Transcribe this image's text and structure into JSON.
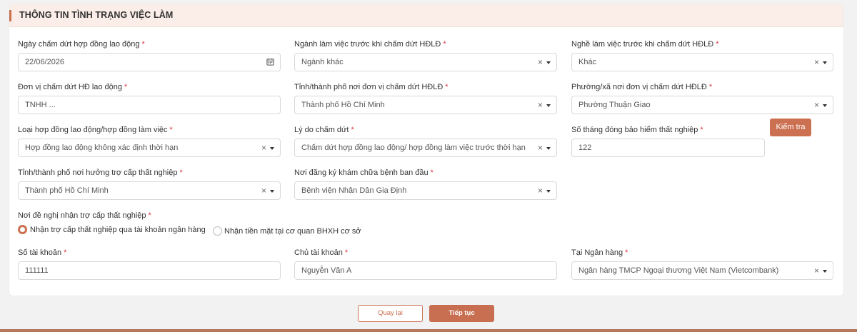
{
  "section": {
    "title": "THÔNG TIN TÌNH TRẠNG VIỆC LÀM"
  },
  "fields": {
    "termination_date": {
      "label": "Ngày chấm dứt hợp đồng lao động",
      "value": "22/06/2026",
      "required": "*"
    },
    "industry": {
      "label": "Ngành làm việc trước khi chấm dứt HĐLĐ",
      "value": "Ngành khác",
      "required": "*"
    },
    "occupation": {
      "label": "Nghề làm việc trước khi chấm dứt HĐLĐ",
      "value": "Khác",
      "required": "*"
    },
    "employer": {
      "label": "Đơn vị chấm dứt HĐ lao động",
      "value": "TNHH ...",
      "required": "*"
    },
    "employer_province": {
      "label": "Tỉnh/thành phố nơi đơn vị chấm dứt HĐLĐ",
      "value": "Thành phố Hồ Chí Minh",
      "required": "*"
    },
    "employer_ward": {
      "label": "Phường/xã nơi đơn vị chấm dứt HĐLĐ",
      "value": "Phường Thuận Giao",
      "required": "*"
    },
    "contract_type": {
      "label": "Loại hợp đồng lao động/hợp đồng làm việc",
      "value": "Hợp đồng lao động không xác định thời hạn",
      "required": "*"
    },
    "termination_reason": {
      "label": "Lý do chấm dứt",
      "value": "Chấm dứt hợp đồng lao động/ hợp đồng làm việc trước thời hạn",
      "required": "*"
    },
    "insurance_months": {
      "label": "Số tháng đóng bảo hiểm thất nghiệp",
      "value": "122",
      "required": "*"
    },
    "benefit_province": {
      "label": "Tỉnh/thành phố nơi hưởng trợ cấp thất nghiệp",
      "value": "Thành phố Hồ Chí Minh",
      "required": "*"
    },
    "health_facility": {
      "label": "Nơi đăng ký khám chữa bệnh ban đầu",
      "value": "Bệnh viện Nhân Dân Gia Định",
      "required": "*"
    },
    "account_number": {
      "label": "Số tài khoản",
      "value": "111111",
      "required": "*"
    },
    "account_holder": {
      "label": "Chủ tài khoản",
      "value": "Nguyễn Văn A",
      "required": "*"
    },
    "bank": {
      "label": "Tại Ngân hàng",
      "value": "Ngân hàng TMCP Ngoại thương Việt Nam (Vietcombank)",
      "required": "*"
    }
  },
  "payment_method": {
    "label": "Nơi đề nghị nhận trợ cấp thất nghiệp",
    "required": "*",
    "options": [
      {
        "label": "Nhận trợ cấp thất nghiệp qua tài khoản ngân hàng",
        "selected": true
      },
      {
        "label": "Nhận tiền mặt tại cơ quan BHXH cơ sở",
        "selected": false
      }
    ]
  },
  "buttons": {
    "check": "Kiểm tra",
    "back": "Quay lại",
    "next": "Tiếp tục"
  },
  "icons": {
    "clear": "×",
    "calendar": "calendar-icon",
    "dropdown": "chevron-down-icon"
  },
  "colors": {
    "accent": "#cc7052",
    "header_bg": "#fbeee8",
    "required": "#d9363e"
  }
}
